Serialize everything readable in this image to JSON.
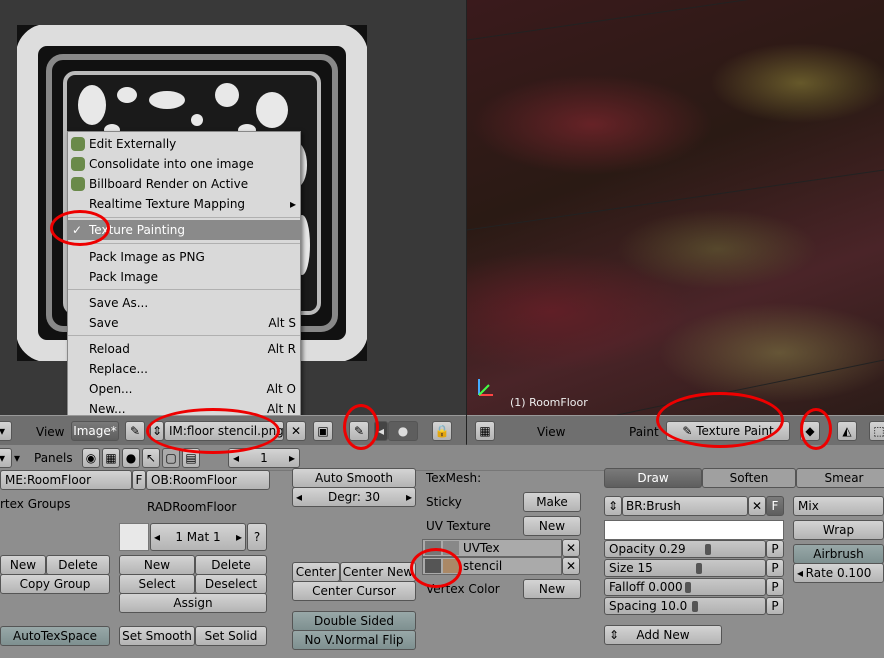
{
  "menu": {
    "items": [
      {
        "label": "Edit Externally",
        "shortcut": "",
        "icon": "plugin-icon"
      },
      {
        "label": "Consolidate into one image",
        "shortcut": "",
        "icon": "plugin-icon"
      },
      {
        "label": "Billboard Render on Active",
        "shortcut": "",
        "icon": "plugin-icon"
      },
      {
        "label": "Realtime Texture Mapping",
        "shortcut": "▸",
        "icon": ""
      },
      {
        "label": "Texture Painting",
        "shortcut": "",
        "icon": "checkmark-icon"
      },
      {
        "label": "Pack Image as PNG",
        "shortcut": "",
        "icon": ""
      },
      {
        "label": "Pack Image",
        "shortcut": "",
        "icon": ""
      },
      {
        "label": "Save As...",
        "shortcut": "",
        "icon": ""
      },
      {
        "label": "Save",
        "shortcut": "Alt S",
        "icon": ""
      },
      {
        "label": "Reload",
        "shortcut": "Alt R",
        "icon": ""
      },
      {
        "label": "Replace...",
        "shortcut": "",
        "icon": ""
      },
      {
        "label": "Open...",
        "shortcut": "Alt O",
        "icon": ""
      },
      {
        "label": "New...",
        "shortcut": "Alt N",
        "icon": ""
      }
    ]
  },
  "image_header": {
    "view": "View",
    "image": "Image*",
    "image_name": "IM:floor stencil.png"
  },
  "viewport": {
    "object_label": "(1) RoomFloor",
    "view": "View",
    "paint": "Paint",
    "mode": "Texture Paint"
  },
  "panels_bar": {
    "label": "Panels",
    "frame": "1"
  },
  "link": {
    "mesh": "ME:RoomFloor",
    "f": "F",
    "object": "OB:RoomFloor",
    "vertex_groups": "rtex Groups",
    "rad": "RADRoomFloor",
    "mat": "1 Mat 1",
    "q": "?",
    "new": "New",
    "delete": "Delete",
    "copy_group": "Copy Group",
    "new2": "New",
    "delete2": "Delete",
    "select": "Select",
    "deselect": "Deselect",
    "assign": "Assign",
    "autotexspace": "AutoTexSpace",
    "set_smooth": "Set Smooth",
    "set_solid": "Set Solid"
  },
  "mesh": {
    "auto_smooth": "Auto Smooth",
    "degr": "Degr: 30",
    "center": "Center",
    "center_new": "Center New",
    "center_cursor": "Center Cursor",
    "double_sided": "Double Sided",
    "no_vnormal_flip": "No V.Normal Flip",
    "texmesh": "TexMesh:",
    "sticky": "Sticky",
    "make": "Make",
    "uv_texture": "UV Texture",
    "new": "New",
    "uv_layers": [
      "UVTex",
      "stencil"
    ],
    "vertex_color": "Vertex Color",
    "new_vc": "New"
  },
  "paint": {
    "tabs": [
      "Draw",
      "Soften",
      "Smear"
    ],
    "brush": "BR:Brush",
    "f": "F",
    "blend": "Mix",
    "wrap": "Wrap",
    "airbrush": "Airbrush",
    "rate": "Rate 0.100",
    "opacity": "Opacity 0.29",
    "size": "Size 15",
    "falloff": "Falloff 0.000",
    "spacing": "Spacing 10.0",
    "p": "P",
    "add_new": "Add New",
    "opacity_v": 0.29,
    "size_v": 0.15,
    "falloff_v": 0.0,
    "spacing_v": 0.1
  }
}
